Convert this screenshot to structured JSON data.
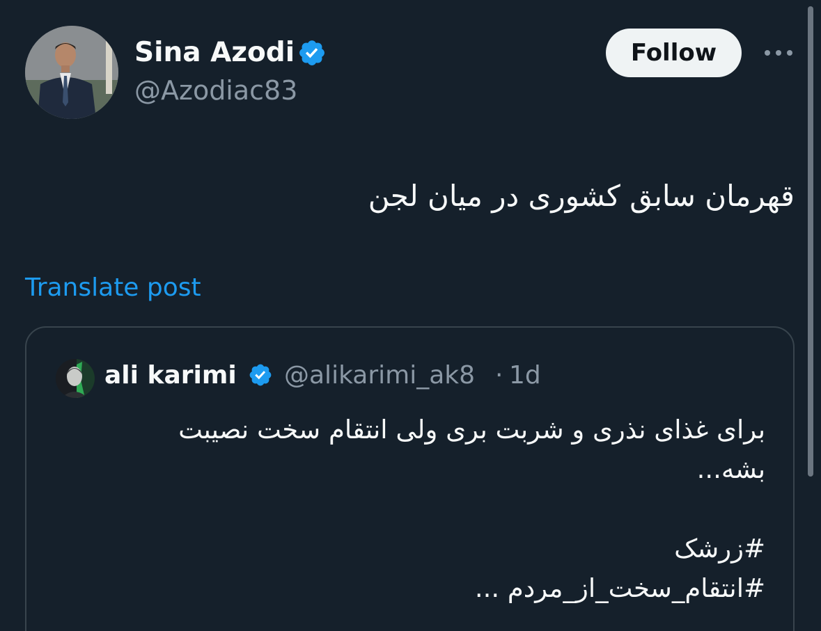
{
  "post": {
    "author": {
      "name": "Sina Azodi",
      "handle": "@Azodiac83",
      "verified": true
    },
    "follow_label": "Follow",
    "text": "قهرمان سابق کشوری در میان لجن",
    "translate_label": "Translate post"
  },
  "quote": {
    "author": {
      "name": "ali karimi",
      "handle": "@alikarimi_ak8",
      "verified": true
    },
    "separator": "·",
    "time": "1d",
    "lines": [
      "برای غذای نذری و شربت بری ولی انتقام سخت نصیبت",
      "بشه...",
      "#زرشک",
      "#انتقام_سخت_از_مردم ..."
    ]
  },
  "colors": {
    "background": "#15202b",
    "accent": "#1d9bf0",
    "secondary_text": "#8b98a5",
    "border": "#38444d"
  },
  "icons": {
    "verified": "verified-badge-icon",
    "more": "more-options-icon"
  }
}
